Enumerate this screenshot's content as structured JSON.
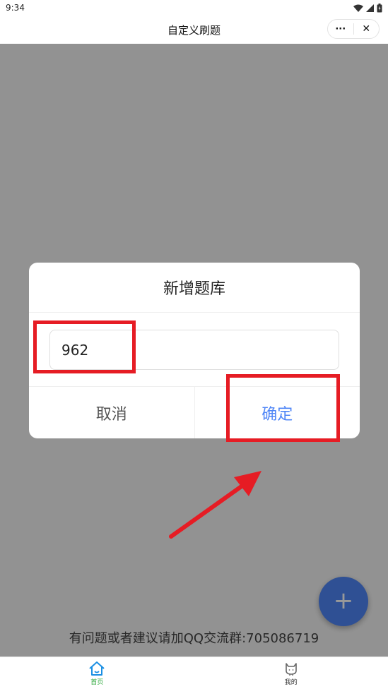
{
  "status_bar": {
    "time": "9:34"
  },
  "nav_bar": {
    "title": "自定义刷题",
    "more_label": "···",
    "close_label": "✕"
  },
  "page": {
    "footer_note": "有问题或者建议请加QQ交流群:705086719",
    "fab_label": "+"
  },
  "dialog": {
    "title": "新增题库",
    "input_value": "962",
    "cancel_label": "取消",
    "confirm_label": "确定"
  },
  "tab_bar": {
    "items": [
      {
        "label": "首页",
        "icon": "home-icon",
        "active": true
      },
      {
        "label": "我的",
        "icon": "profile-cat-icon",
        "active": false
      }
    ]
  },
  "colors": {
    "accent": "#4f86f7",
    "active_tab": "#2fa83c",
    "annotation": "#e61c24"
  }
}
